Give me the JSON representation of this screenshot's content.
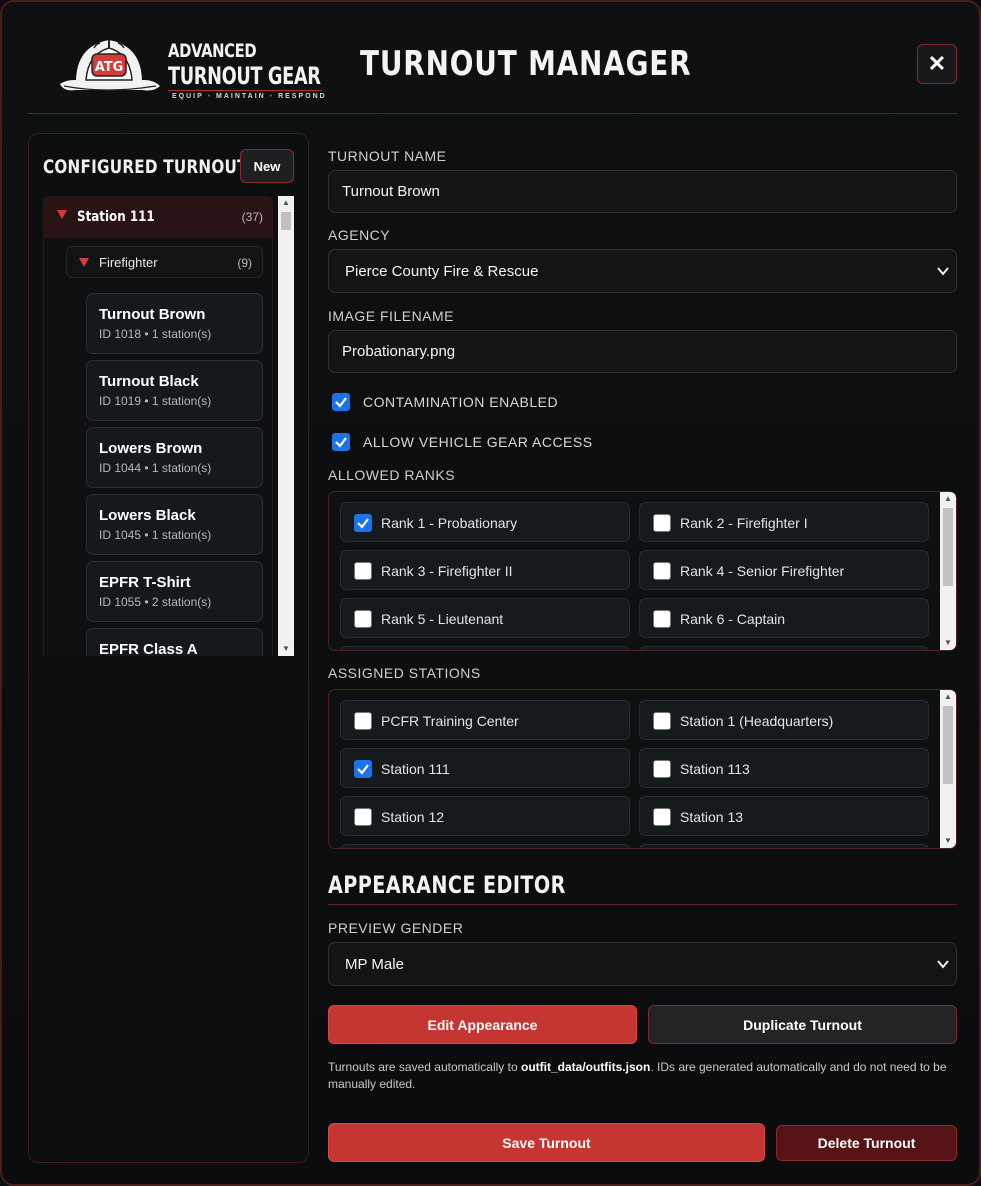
{
  "colors": {
    "accent": "#c53532",
    "dark_red": "#561416",
    "checkbox_on": "#1a73e8",
    "background": "#0c0d0e"
  },
  "header": {
    "logo": {
      "mark": "ATG",
      "line1": "ADVANCED",
      "line2": "TURNOUT GEAR",
      "tag_words": [
        "EQUIP",
        "MAINTAIN",
        "RESPOND"
      ]
    },
    "title": "TURNOUT MANAGER",
    "close_label": "✕"
  },
  "sidebar": {
    "title": "CONFIGURED TURNOUTS",
    "new_label": "New",
    "station": {
      "label": "Station 111",
      "count": "(37)"
    },
    "rank": {
      "label": "Firefighter",
      "count": "(9)"
    },
    "outfits": [
      {
        "name": "Turnout Brown",
        "meta": "ID 1018 • 1 station(s)"
      },
      {
        "name": "Turnout Black",
        "meta": "ID 1019 • 1 station(s)"
      },
      {
        "name": "Lowers Brown",
        "meta": "ID 1044 • 1 station(s)"
      },
      {
        "name": "Lowers Black",
        "meta": "ID 1045 • 1 station(s)"
      },
      {
        "name": "EPFR T-Shirt",
        "meta": "ID 1055 • 2 station(s)"
      },
      {
        "name": "EPFR Class A",
        "meta": ""
      }
    ]
  },
  "form": {
    "turnout_name": {
      "label": "TURNOUT NAME",
      "value": "Turnout Brown"
    },
    "agency": {
      "label": "AGENCY",
      "value": "Pierce County Fire & Rescue"
    },
    "image_filename": {
      "label": "IMAGE FILENAME",
      "value": "Probationary.png"
    },
    "contamination": {
      "label": "CONTAMINATION ENABLED",
      "checked": true
    },
    "vehicle_access": {
      "label": "ALLOW VEHICLE GEAR ACCESS",
      "checked": true
    },
    "allowed_ranks": {
      "label": "ALLOWED RANKS",
      "options": [
        {
          "label": "Rank 1 - Probationary",
          "checked": true
        },
        {
          "label": "Rank 2 - Firefighter I",
          "checked": false
        },
        {
          "label": "Rank 3 - Firefighter II",
          "checked": false
        },
        {
          "label": "Rank 4 - Senior Firefighter",
          "checked": false
        },
        {
          "label": "Rank 5 - Lieutenant",
          "checked": false
        },
        {
          "label": "Rank 6 - Captain",
          "checked": false
        }
      ]
    },
    "assigned_stations": {
      "label": "ASSIGNED STATIONS",
      "options": [
        {
          "label": "PCFR Training Center",
          "checked": false
        },
        {
          "label": "Station 1 (Headquarters)",
          "checked": false
        },
        {
          "label": "Station 111",
          "checked": true
        },
        {
          "label": "Station 113",
          "checked": false
        },
        {
          "label": "Station 12",
          "checked": false
        },
        {
          "label": "Station 13",
          "checked": false
        }
      ]
    }
  },
  "appearance": {
    "title": "APPEARANCE EDITOR",
    "preview_gender": {
      "label": "PREVIEW GENDER",
      "value": "MP Male"
    },
    "edit_label": "Edit Appearance",
    "duplicate_label": "Duplicate Turnout",
    "note_prefix": "Turnouts are saved automatically to ",
    "note_path": "outfit_data/outfits.json",
    "note_suffix": ". IDs are generated automatically and do not need to be manually edited."
  },
  "footer": {
    "save_label": "Save Turnout",
    "delete_label": "Delete Turnout"
  }
}
